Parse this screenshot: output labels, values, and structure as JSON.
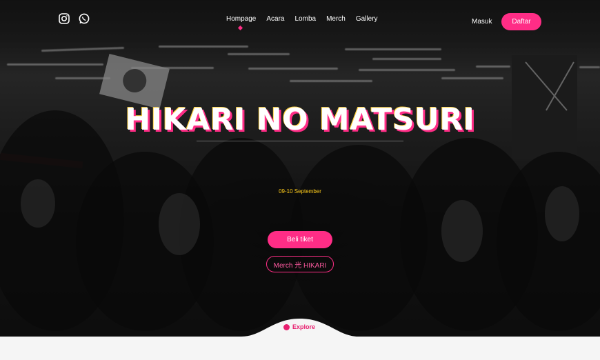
{
  "social": {
    "instagram_icon": "instagram-icon",
    "whatsapp_icon": "whatsapp-icon"
  },
  "nav": {
    "items": [
      "Hompage",
      "Acara",
      "Lomba",
      "Merch",
      "Gallery"
    ],
    "active_index": 0
  },
  "auth": {
    "login_label": "Masuk",
    "register_label": "Daftar"
  },
  "hero": {
    "title": "HIKARI NO MATSURI",
    "date": "09-10 September",
    "buy_ticket_label": "Beli tiket",
    "merch_label": "Merch 光 HIKARI"
  },
  "explore": {
    "label": "Explore",
    "icon": "compass-icon"
  },
  "colors": {
    "accent": "#ff2d86",
    "date": "#ffcc1a",
    "title_shadow": "#ff2d86"
  }
}
